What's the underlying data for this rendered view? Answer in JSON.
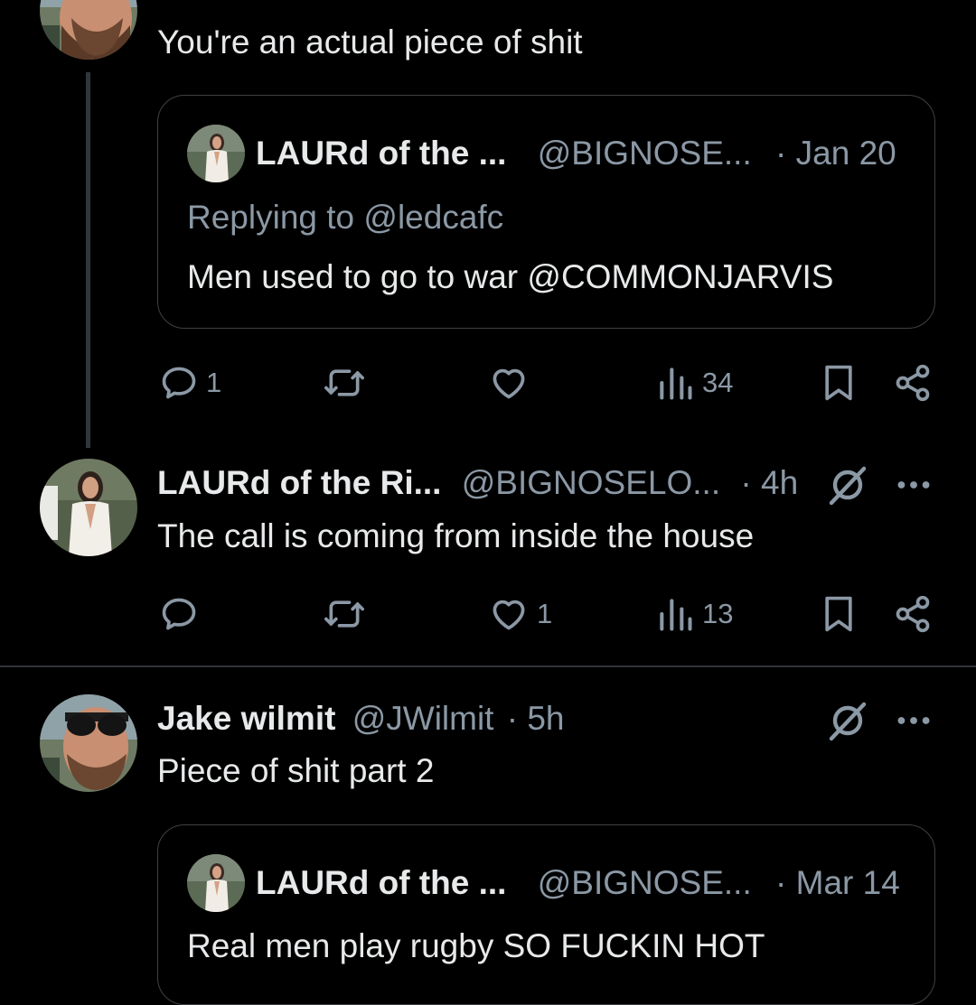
{
  "colors": {
    "background": "#000000",
    "text": "#e7e9ea",
    "muted": "#8b98a5",
    "border": "#3e4144"
  },
  "tweet1": {
    "text": "You're an actual piece of shit",
    "quote": {
      "name": "LAURd of the ...",
      "handle": "@BIGNOSE...",
      "date": "· Jan 20",
      "replying": "Replying to @ledcafc",
      "text": "Men used to go to war @COMMONJARVIS"
    },
    "actions": {
      "replies": "1",
      "retweets": "",
      "likes": "",
      "views": "34"
    }
  },
  "tweet2": {
    "name": "LAURd of the Ri...",
    "handle": "@BIGNOSELO...",
    "time": "· 4h",
    "text": "The call is coming from inside the house",
    "actions": {
      "replies": "",
      "retweets": "",
      "likes": "1",
      "views": "13"
    }
  },
  "tweet3": {
    "name": "Jake wilmit",
    "handle": "@JWilmit",
    "time": "· 5h",
    "text": "Piece of shit part 2",
    "quote": {
      "name": "LAURd of the ...",
      "handle": "@BIGNOSE...",
      "date": "· Mar 14",
      "text": "Real men play rugby SO FUCKIN HOT"
    }
  },
  "icons": [
    "reply-icon",
    "retweet-icon",
    "like-icon",
    "views-icon",
    "bookmark-icon",
    "share-icon",
    "grok-icon",
    "more-icon"
  ]
}
